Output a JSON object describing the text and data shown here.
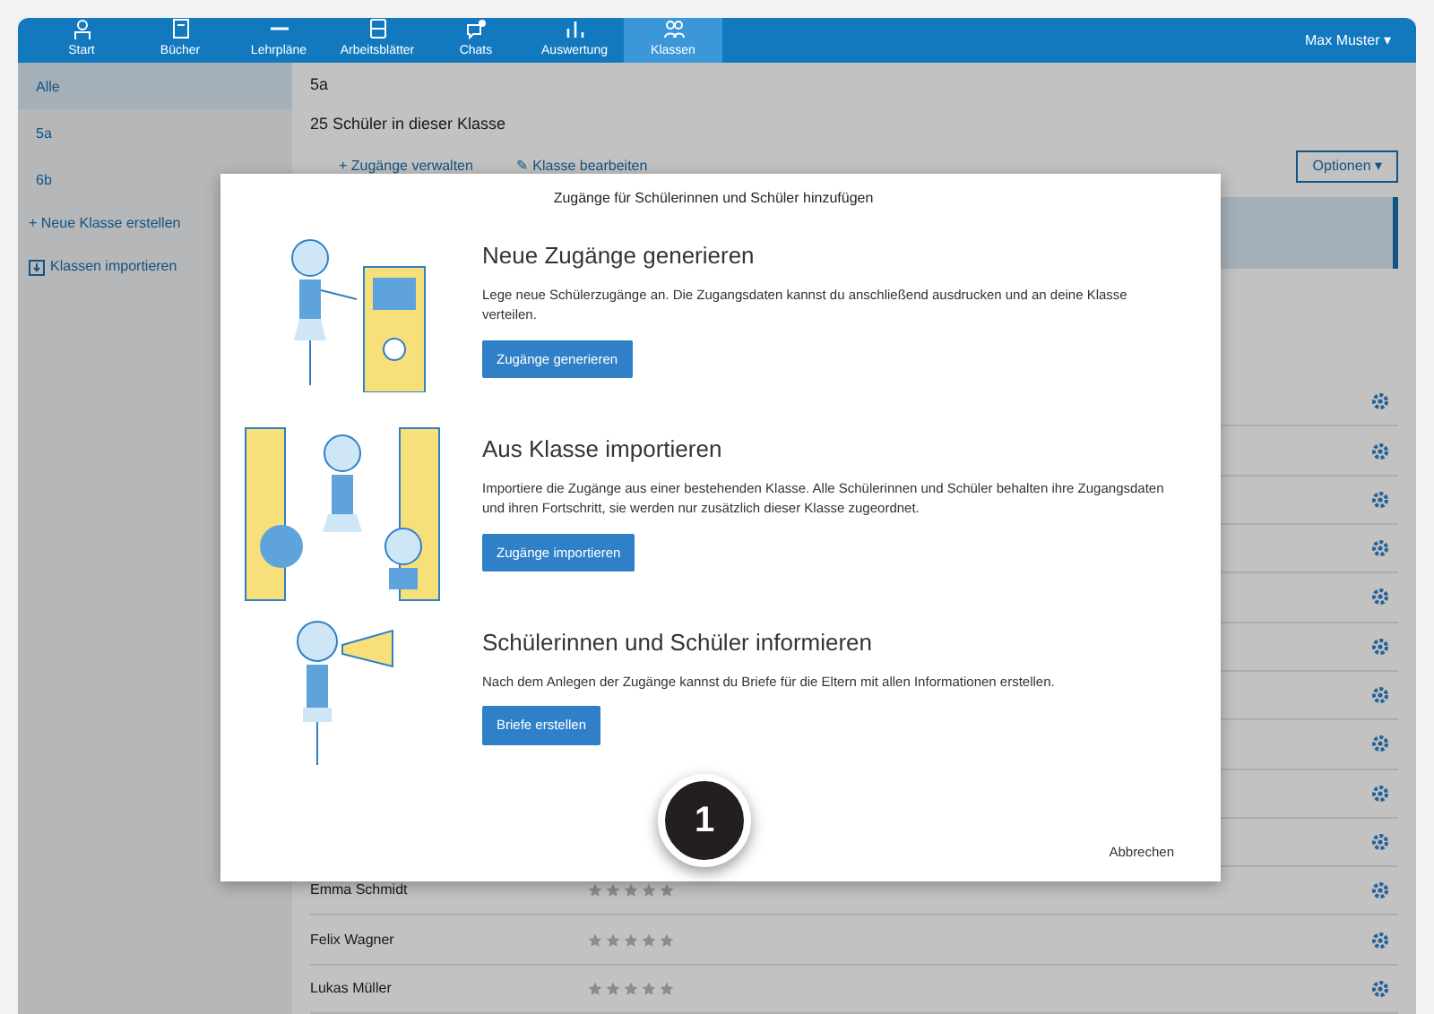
{
  "navbar": {
    "items": [
      {
        "label": "Start",
        "selected": false
      },
      {
        "label": "Bücher",
        "selected": false
      },
      {
        "label": "Lehrpläne",
        "selected": false
      },
      {
        "label": "Arbeitsblätter",
        "selected": false
      },
      {
        "label": "Chats",
        "selected": false
      },
      {
        "label": "Auswertung",
        "selected": false
      },
      {
        "label": "Klassen",
        "selected": true
      }
    ],
    "user": "Max Muster ▾"
  },
  "sidebar": {
    "items": [
      {
        "label": "Alle",
        "selected": true
      },
      {
        "label": "5a",
        "selected": false
      },
      {
        "label": "6b",
        "selected": false
      }
    ],
    "links": [
      {
        "label": "+ Neue Klasse erstellen",
        "kind": "plus"
      },
      {
        "label": "Klassen importieren",
        "kind": "import"
      }
    ]
  },
  "content": {
    "title": "5a",
    "subtitle": "25 Schüler in dieser Klasse",
    "links": [
      "+ Zugänge verwalten",
      "✎ Klasse bearbeiten"
    ],
    "options_button": "Optionen ▾",
    "rows": [
      {
        "kind": "covered"
      },
      {
        "kind": "covered"
      },
      {
        "kind": "covered"
      },
      {
        "kind": "covered"
      },
      {
        "kind": "covered"
      },
      {
        "kind": "covered"
      },
      {
        "kind": "covered"
      },
      {
        "kind": "covered"
      },
      {
        "kind": "covered"
      },
      {
        "kind": "covered"
      },
      {
        "kind": "student",
        "name": "Emma Schmidt",
        "stars": 0
      },
      {
        "kind": "student",
        "name": "Felix Wagner",
        "stars": 0
      },
      {
        "kind": "student",
        "name": "Lukas Müller",
        "stars": 0
      }
    ]
  },
  "dialog": {
    "title": "Zugänge für Schülerinnen und Schüler hinzufügen",
    "sections": [
      {
        "kind": "generate",
        "heading": "Neue Zugänge generieren",
        "text": "Lege neue Schülerzugänge an. Die Zugangsdaten kannst du anschließend ausdrucken und an deine Klasse verteilen.",
        "button": "Zugänge generieren"
      },
      {
        "kind": "import",
        "heading": "Aus Klasse importieren",
        "text": "Importiere die Zugänge aus einer bestehenden Klasse. Alle Schülerinnen und Schüler behalten ihre Zugangsdaten und ihren Fortschritt, sie werden nur zusätzlich dieser Klasse zugeordnet.",
        "button": "Zugänge importieren"
      },
      {
        "kind": "inform",
        "heading": "Schülerinnen und Schüler informieren",
        "text": "Nach dem Anlegen der Zugänge kannst du Briefe für die Eltern mit allen Informationen erstellen.",
        "button": "Briefe erstellen"
      }
    ],
    "close": "Abbrechen",
    "callout": "1"
  }
}
